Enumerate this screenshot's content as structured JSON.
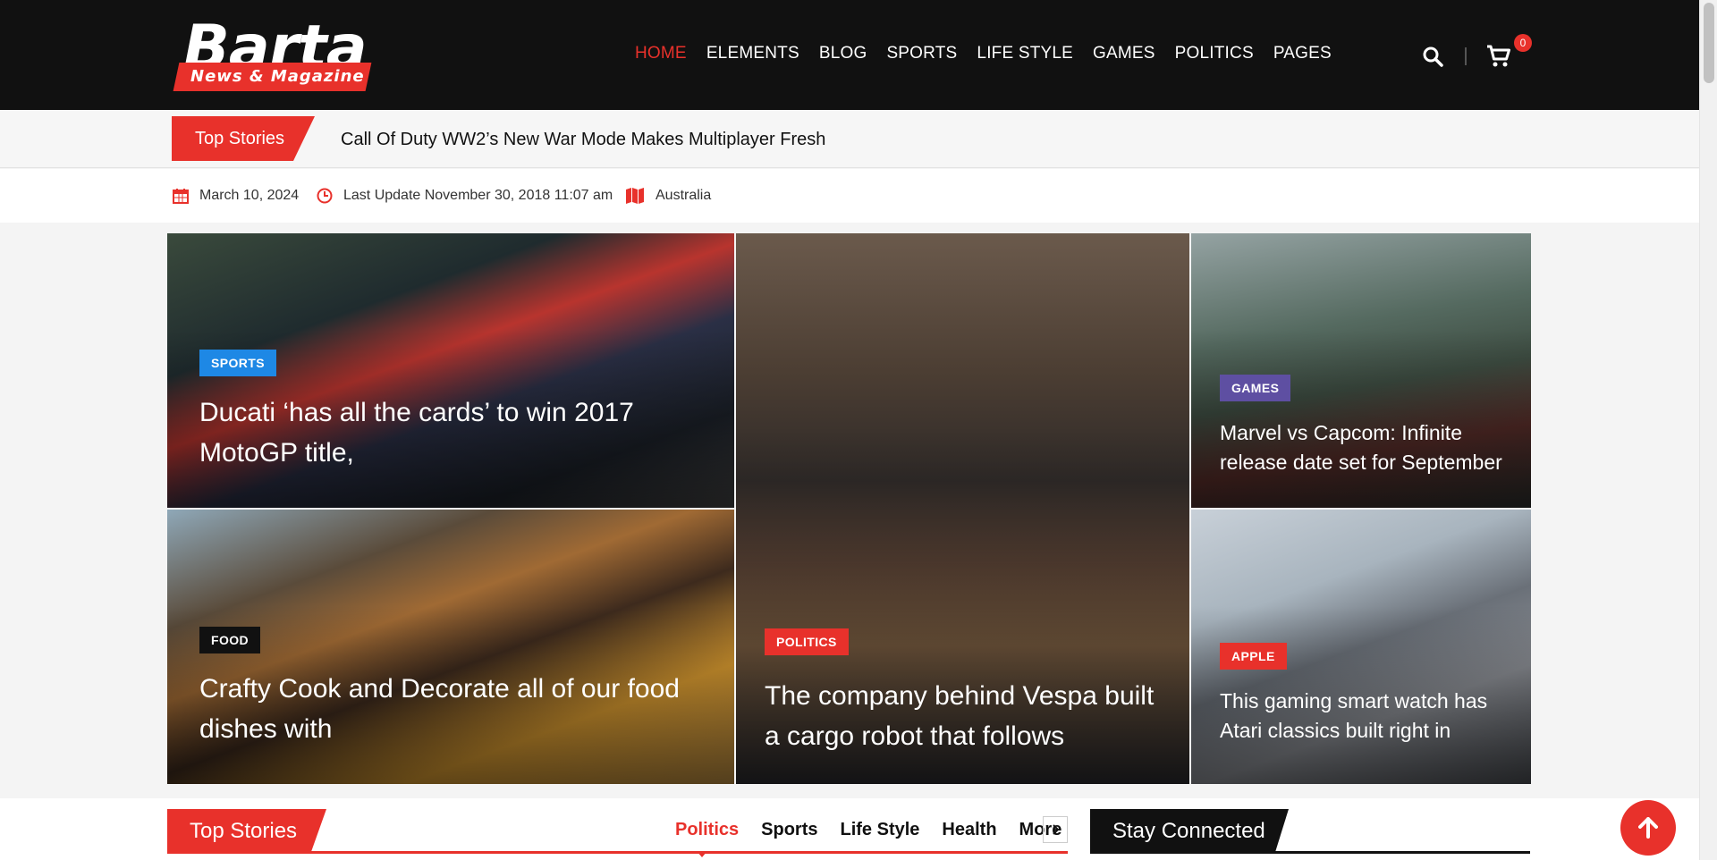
{
  "header": {
    "logo_title": "Barta",
    "logo_tagline": "News & Magazine",
    "nav": [
      "HOME",
      "ELEMENTS",
      "BLOG",
      "SPORTS",
      "LIFE STYLE",
      "GAMES",
      "POLITICS",
      "PAGES"
    ],
    "cart_count": "0"
  },
  "ticker": {
    "label": "Top Stories",
    "headline": "Call Of Duty WW2’s New War Mode Makes Multiplayer Fresh"
  },
  "info": {
    "date": "March 10, 2024",
    "last_update": "Last Update November 30, 2018 11:07 am",
    "location": "Australia"
  },
  "cards": [
    {
      "category": "SPORTS",
      "title_line1": "Ducati ‘has all the cards’ to win 2017",
      "title_line2": "MotoGP title,",
      "tag_color": "#1e88e5"
    },
    {
      "category": "POLITICS",
      "title_line1": "The company behind Vespa built",
      "title_line2": "a cargo robot that follows",
      "tag_color": "#e8312b"
    },
    {
      "category": "GAMES",
      "title_line1": "Marvel vs Capcom: Infinite",
      "title_line2": "release date set for September",
      "tag_color": "#5e4fa2"
    },
    {
      "category": "FOOD",
      "title_line1": "Crafty Cook and Decorate all of our food",
      "title_line2": "dishes with",
      "tag_color": "#111111"
    },
    {
      "category": "APPLE",
      "title_line1": "This gaming smart watch has",
      "title_line2": "Atari classics built right in",
      "tag_color": "#e8312b"
    }
  ],
  "bottom": {
    "top_stories_label": "Top Stories",
    "tabs": [
      "Politics",
      "Sports",
      "Life Style",
      "Health",
      "More"
    ],
    "stay_connected_label": "Stay Connected"
  },
  "colors": {
    "accent": "#e8312b",
    "header_bg": "#111111"
  }
}
